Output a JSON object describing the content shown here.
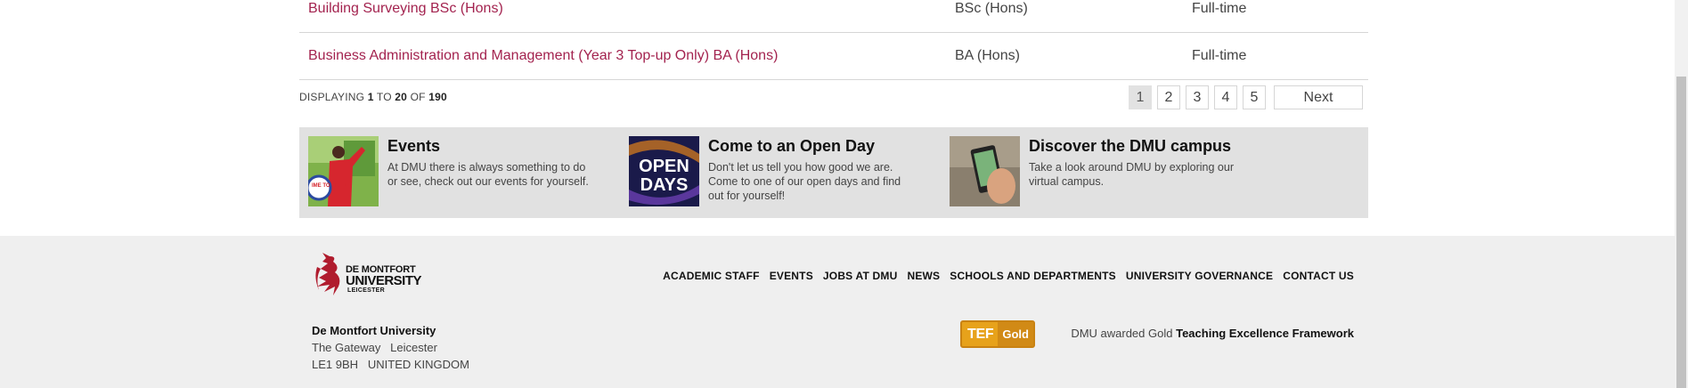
{
  "courses": [
    {
      "name": "Building Surveying BSc (Hons)",
      "award": "BSc (Hons)",
      "mode": "Full-time"
    },
    {
      "name": "Business Administration and Management (Year 3 Top-up Only) BA (Hons)",
      "award": "BA (Hons)",
      "mode": "Full-time"
    }
  ],
  "pagination": {
    "label_displaying": "DISPLAYING",
    "from": "1",
    "label_to": "TO",
    "to": "20",
    "label_of": "OF",
    "total": "190",
    "pages": [
      "1",
      "2",
      "3",
      "4",
      "5"
    ],
    "current_page": "1",
    "next_label": "Next"
  },
  "promo": {
    "events": {
      "title": "Events",
      "desc": "At DMU there is always something to do or see, check out our events for yourself.",
      "badge_text": "IME TO HELP"
    },
    "open_day": {
      "title": "Come to an Open Day",
      "desc": "Don't let us tell you how good we are. Come to one of our open days and find out for yourself!",
      "image_line1": "OPEN",
      "image_line2": "DAYS"
    },
    "campus": {
      "title": "Discover the DMU campus",
      "desc": "Take a look around DMU by exploring our virtual campus."
    }
  },
  "footer": {
    "logo": {
      "line1": "DE MONTFORT",
      "line2": "UNIVERSITY",
      "line3": "LEICESTER"
    },
    "nav": [
      "ACADEMIC STAFF",
      "EVENTS",
      "JOBS AT DMU",
      "NEWS",
      "SCHOOLS AND DEPARTMENTS",
      "UNIVERSITY GOVERNANCE",
      "CONTACT US"
    ],
    "address": {
      "org": "De Montfort University",
      "line1": "The Gateway   Leicester",
      "line2": "LE1 9BH   UNITED KINGDOM"
    },
    "tef": {
      "badge1": "TEF",
      "badge2": "Gold",
      "text_prefix": "DMU awarded Gold",
      "text_strong": "Teaching Excellence Framework"
    }
  },
  "colors": {
    "link": "#a3234f",
    "promo_bg": "#e1e1e1",
    "footer_bg": "#efefef",
    "tef_gold": "#e7a21b"
  }
}
